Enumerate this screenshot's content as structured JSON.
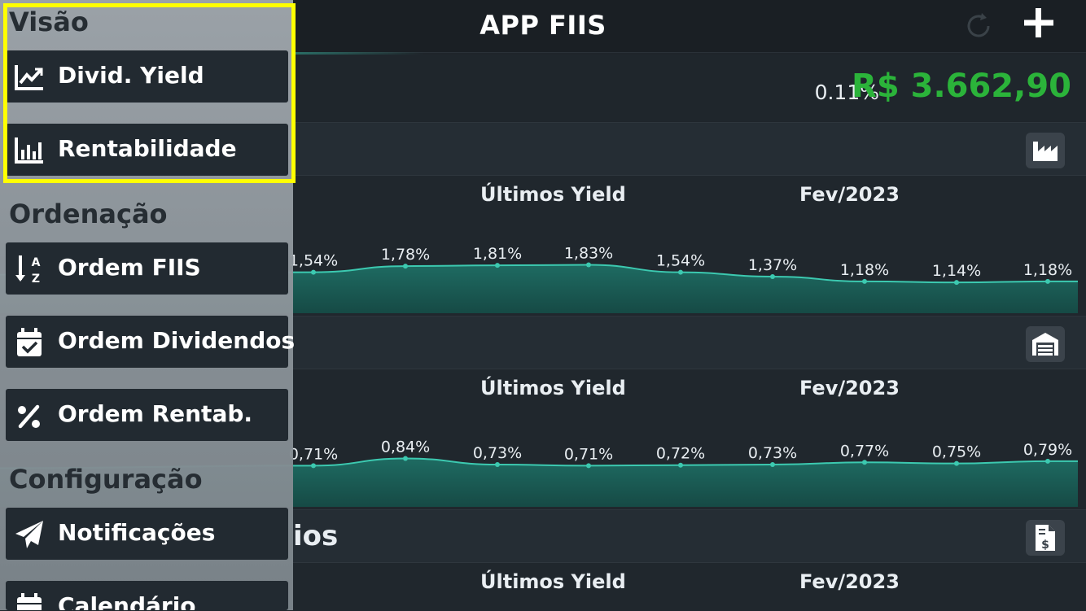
{
  "header": {
    "title": "APP FIIS",
    "refresh_icon": "refresh-icon",
    "add_icon": "plus-icon"
  },
  "summary": {
    "percent": "0.11%",
    "total": "R$ 3.662,90",
    "total_color": "#2bb33a"
  },
  "cards": [
    {
      "title": "",
      "icon": "factory-icon",
      "row_label": "Últimos Yield",
      "month_label": "Fev/2023",
      "yields": [
        "1,54%",
        "1,78%",
        "1,81%",
        "1,83%",
        "1,54%",
        "1,37%",
        "1,18%",
        "1,14%",
        "1,18%"
      ],
      "yield_values": [
        1.54,
        1.78,
        1.81,
        1.83,
        1.54,
        1.37,
        1.18,
        1.14,
        1.18
      ]
    },
    {
      "title": "",
      "icon": "warehouse-icon",
      "row_label": "Últimos Yield",
      "month_label": "Fev/2023",
      "yields": [
        "0,71%",
        "0,84%",
        "0,73%",
        "0,71%",
        "0,72%",
        "0,73%",
        "0,77%",
        "0,75%",
        "0,79%"
      ],
      "yield_values": [
        0.71,
        0.84,
        0.73,
        0.71,
        0.72,
        0.73,
        0.77,
        0.75,
        0.79
      ]
    },
    {
      "title": "ios",
      "icon": "invoice-dollar-icon",
      "row_label": "Últimos Yield",
      "month_label": "Fev/2023"
    }
  ],
  "chart_colors": {
    "line": "#3cc9b0",
    "fill_top": "#1e6b62",
    "fill_bottom": "#164a45"
  },
  "menu": {
    "visao_title": "Visão",
    "divid_yield": "Divid. Yield",
    "rentabilidade": "Rentabilidade",
    "ordenacao_title": "Ordenação",
    "ordem_fiis": "Ordem FIIS",
    "ordem_dividendos": "Ordem Dividendos",
    "ordem_rentab": "Ordem Rentab.",
    "configuracao_title": "Configuração",
    "notificacoes": "Notificações",
    "calendario": "Calendário",
    "highlight_color": "#ffff00"
  }
}
